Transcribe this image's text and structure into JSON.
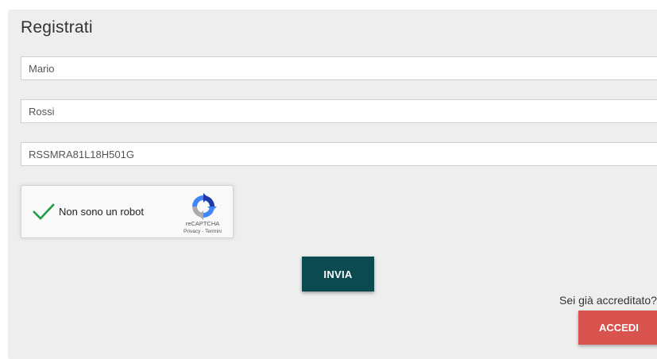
{
  "form": {
    "title": "Registrati",
    "fields": [
      {
        "name": "first-name",
        "value": "Mario"
      },
      {
        "name": "last-name",
        "value": "Rossi"
      },
      {
        "name": "fiscal-code",
        "value": "RSSMRA81L18H501G"
      }
    ],
    "submit_label": "INVIA"
  },
  "captcha": {
    "label": "Non sono un robot",
    "brand": "reCAPTCHA",
    "links": "Privacy - Termini",
    "checked": true,
    "check_color": "#1e9e4a"
  },
  "login": {
    "prompt": "Sei già accreditato?",
    "button_label": "ACCEDI"
  },
  "colors": {
    "panel_bg": "#eeeeee",
    "submit_bg": "#0b4a4f",
    "login_bg": "#d9534f"
  }
}
